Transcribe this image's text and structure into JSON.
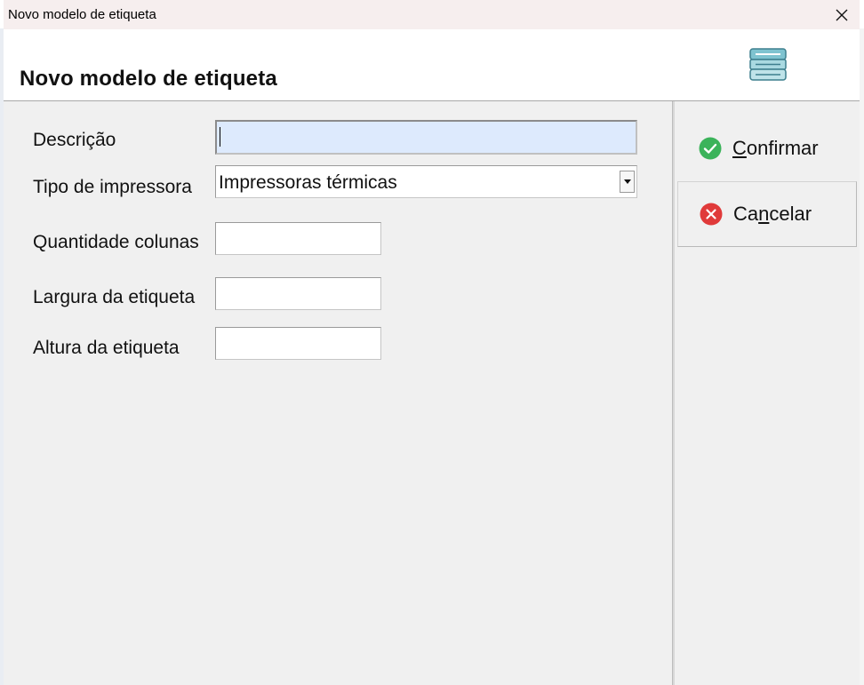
{
  "window": {
    "title": "Novo modelo de etiqueta",
    "close_glyph": "✕"
  },
  "header": {
    "title": "Novo modelo de etiqueta",
    "icon": "label-stack-icon"
  },
  "form": {
    "descricao": {
      "label": "Descrição",
      "value": ""
    },
    "tipo_impressora": {
      "label": "Tipo de impressora",
      "value": "Impressoras térmicas"
    },
    "quantidade_colunas": {
      "label": "Quantidade colunas",
      "value": ""
    },
    "largura_etiqueta": {
      "label": "Largura da etiqueta",
      "value": ""
    },
    "altura_etiqueta": {
      "label": "Altura da etiqueta",
      "value": ""
    }
  },
  "actions": {
    "confirm": {
      "before": "",
      "mnemonic": "C",
      "after": "onfirmar",
      "icon": "check-circle-icon",
      "color": "#3bb35a"
    },
    "cancel": {
      "before": "Ca",
      "mnemonic": "n",
      "after": "celar",
      "icon": "x-circle-icon",
      "color": "#e03a3a"
    }
  }
}
